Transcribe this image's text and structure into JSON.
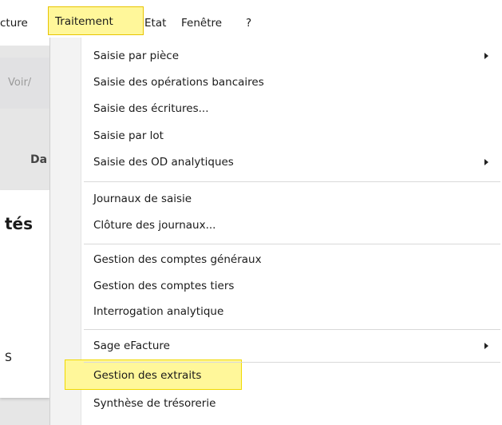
{
  "menubar": {
    "items": [
      {
        "label": "cture"
      },
      {
        "label": "Traitement"
      },
      {
        "label": "Etat"
      },
      {
        "label": "Fenêtre"
      },
      {
        "label": "?"
      }
    ]
  },
  "background": {
    "voir": "Voir/",
    "da": "Da",
    "tes": "tés",
    "s": "S"
  },
  "menu": {
    "items": [
      {
        "label": "Saisie par pièce",
        "submenu": true
      },
      {
        "label": "Saisie des opérations bancaires"
      },
      {
        "label": "Saisie des écritures..."
      },
      {
        "label": "Saisie par lot"
      },
      {
        "label": "Saisie des OD analytiques",
        "submenu": true
      },
      {
        "label": "Journaux de saisie"
      },
      {
        "label": "Clôture des journaux..."
      },
      {
        "label": "Gestion des comptes généraux"
      },
      {
        "label": "Gestion des comptes tiers"
      },
      {
        "label": "Interrogation analytique"
      },
      {
        "label": "Sage eFacture",
        "submenu": true
      },
      {
        "label": "Gestion des extraits",
        "highlighted": true
      },
      {
        "label": "Synthèse de trésorerie"
      }
    ]
  },
  "colors": {
    "highlight": "#fff79a",
    "highlight_border": "#f0d900",
    "background_app": "#e6e6e6"
  }
}
